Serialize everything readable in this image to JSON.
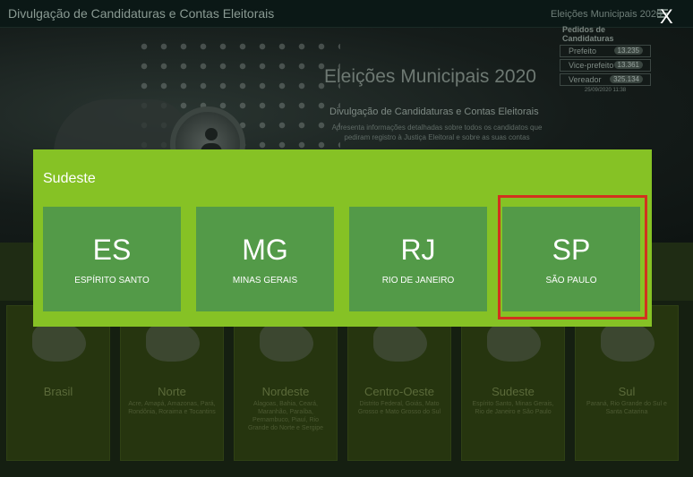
{
  "header": {
    "app_title": "Divulgação de Candidaturas e Contas Eleitorais",
    "right_title": "Eleições Municipais 2020",
    "close_label": "X"
  },
  "hero": {
    "title": "Eleições Municipais 2020",
    "subtitle": "Divulgação de Candidaturas e Contas Eleitorais",
    "description": "Apresenta informações detalhadas sobre todos os candidatos que pediram registro à Justiça Eleitoral e sobre as suas contas"
  },
  "stats": {
    "title": "Pedidos de Candidaturas",
    "rows": [
      {
        "label": "Prefeito",
        "value": "13.235"
      },
      {
        "label": "Vice-prefeito",
        "value": "13.361"
      },
      {
        "label": "Vereador",
        "value": "325.134"
      }
    ],
    "updated": "25/09/2020 11:38"
  },
  "regions": [
    {
      "name": "Brasil",
      "states": ""
    },
    {
      "name": "Norte",
      "states": "Acre, Amapá, Amazonas, Pará, Rondônia, Roraima e Tocantins"
    },
    {
      "name": "Nordeste",
      "states": "Alagoas, Bahia, Ceará, Maranhão, Paraíba, Pernambuco, Piauí, Rio Grande do Norte e Sergipe"
    },
    {
      "name": "Centro-Oeste",
      "states": "Distrito Federal, Goiás, Mato Grosso e Mato Grosso do Sul"
    },
    {
      "name": "Sudeste",
      "states": "Espírito Santo, Minas Gerais, Rio de Janeiro e São Paulo"
    },
    {
      "name": "Sul",
      "states": "Paraná, Rio Grande do Sul e Santa Catarina"
    }
  ],
  "modal": {
    "title": "Sudeste",
    "states": [
      {
        "abbr": "ES",
        "name": "ESPÍRITO SANTO"
      },
      {
        "abbr": "MG",
        "name": "MINAS GERAIS"
      },
      {
        "abbr": "RJ",
        "name": "RIO DE JANEIRO"
      },
      {
        "abbr": "SP",
        "name": "SÃO PAULO"
      }
    ],
    "highlighted_state": "SP"
  },
  "colors": {
    "modal_bg": "#86c225",
    "tile_bg": "#539a48",
    "highlight_border": "#d2321e"
  }
}
